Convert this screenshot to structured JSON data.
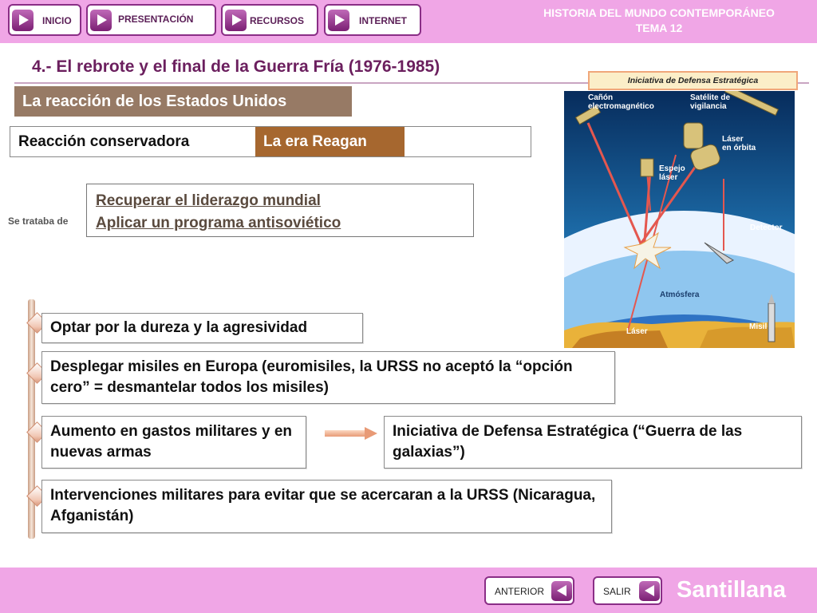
{
  "header": {
    "nav": [
      {
        "label": "INICIO"
      },
      {
        "label": "PRESENTACIÓN"
      },
      {
        "label": "RECURSOS"
      },
      {
        "label": "INTERNET"
      }
    ],
    "subject": "HISTORIA DEL MUNDO CONTEMPORÁNEO",
    "unit": "TEMA 12"
  },
  "title": "4.- El rebrote y el final de la Guerra Fría (1976-1985)",
  "image": {
    "caption": "Iniciativa de Defensa Estratégica",
    "labels": {
      "canon": "Cañón\nelectromagnético",
      "satelite": "Satélite de\nvigilancia",
      "laser_orbita": "Láser\nen órbita",
      "espejo": "Espejo\nláser",
      "detector": "Detector",
      "atmosfera": "Atmósfera",
      "laser": "Láser",
      "misil": "Misil"
    }
  },
  "section": "La reacción de los Estados Unidos",
  "reaction": {
    "left": "Reacción conservadora",
    "right": "La era Reagan"
  },
  "goals": {
    "intro": "Se trataba de",
    "items": [
      "Recuperar el liderazgo mundial",
      "Aplicar un programa antisoviético"
    ]
  },
  "points": [
    {
      "text": "Optar por la dureza y la agresividad"
    },
    {
      "text": "Desplegar misiles en Europa (euromisiles, la URSS no aceptó la “opción cero” = desmantelar todos los misiles)"
    },
    {
      "text": "Aumento en gastos militares y en nuevas armas"
    },
    {
      "text": "Intervenciones militares  para evitar que se acercaran a la URSS (Nicaragua, Afganistán)"
    }
  ],
  "consequence": "Iniciativa de Defensa Estratégica (“Guerra de las galaxias”)",
  "footer": {
    "prev": "ANTERIOR",
    "exit": "SALIR",
    "brand": "Santillana"
  },
  "colors": {
    "bar": "#f0a6e6",
    "title": "#6b1f5e",
    "section_bg": "#977a65",
    "era_bg": "#a6672f"
  }
}
